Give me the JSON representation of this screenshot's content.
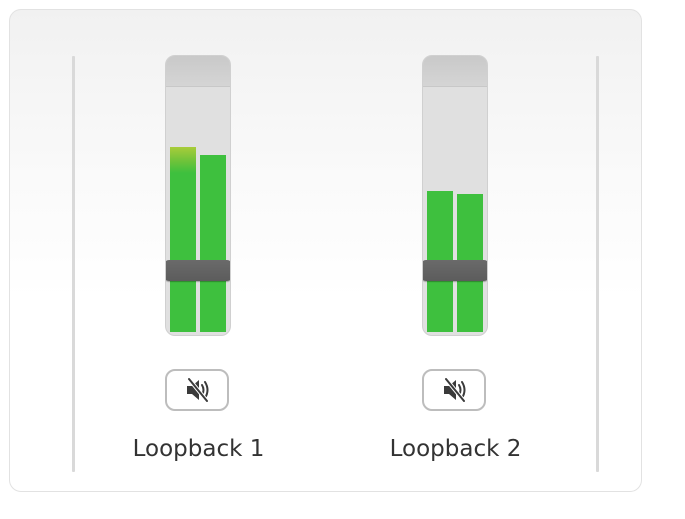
{
  "panel": {
    "border_color": "#e2e2e2"
  },
  "channels": [
    {
      "label": "Loopback 1",
      "meter_left_level": 0.67,
      "meter_right_level": 0.64,
      "fader_level": 0.21,
      "mute_icon": "speaker-muted-icon",
      "meter_color": "#3ec03e",
      "peak_color": "#a9cc3a"
    },
    {
      "label": "Loopback 2",
      "meter_left_level": 0.51,
      "meter_right_level": 0.5,
      "fader_level": 0.21,
      "mute_icon": "speaker-muted-icon",
      "meter_color": "#3ec03e"
    }
  ]
}
